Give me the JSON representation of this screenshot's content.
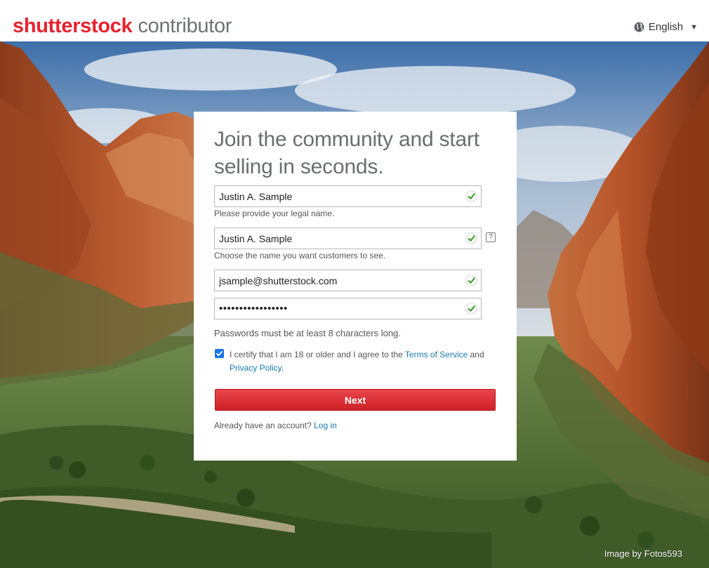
{
  "header": {
    "logo_brand": "shutterstock",
    "logo_suffix": "contributor",
    "language": "English",
    "globe_icon": "globe-icon",
    "caret_icon": "caret-down-icon"
  },
  "signup": {
    "heading": "Join the community and start selling in seconds.",
    "legal_name_value": "Justin A. Sample",
    "legal_name_hint": "Please provide your legal name.",
    "display_name_value": "Justin A. Sample",
    "display_name_hint": "Choose the name you want customers to see.",
    "help_icon": "?",
    "email_value": "jsample@shutterstock.com",
    "password_masked": "•••••••••••••••••",
    "password_rule": "Passwords must be at least 8 characters long.",
    "agree_prefix": "I certify that I am 18 or older and I agree to the ",
    "terms_link": "Terms of Service",
    "agree_and": " and ",
    "privacy_link": "Privacy Policy",
    "agree_suffix": ".",
    "agree_checked": true,
    "next_label": "Next",
    "login_prompt": "Already have an account? ",
    "login_link": "Log in"
  },
  "credit": "Image by Fotos593",
  "colors": {
    "brand_red": "#e8212e",
    "button_red": "#d9353a",
    "link_blue": "#177bb0",
    "check_green": "#3f9b2e"
  }
}
